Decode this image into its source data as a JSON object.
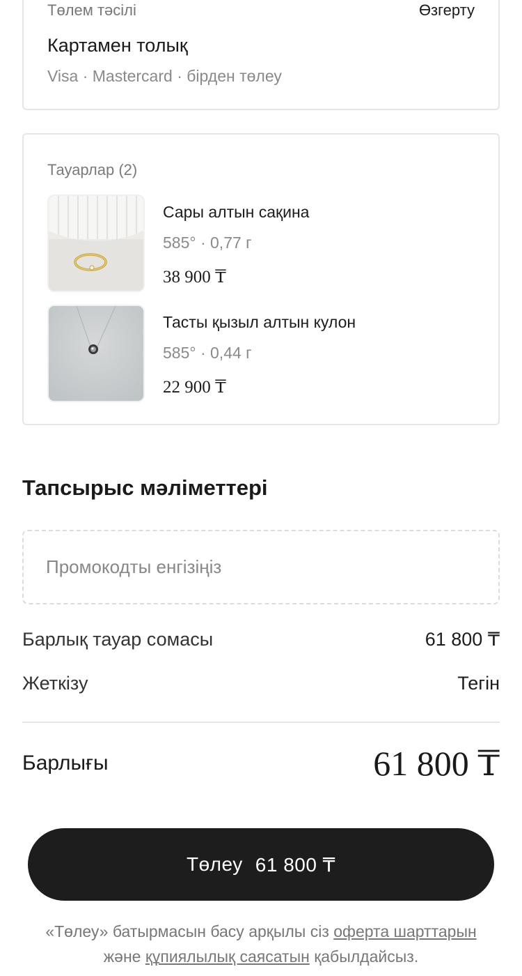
{
  "payment": {
    "label": "Төлем тәсілі",
    "change_label": "Өзгерту",
    "method": "Картамен толық",
    "subtitle": "Visa · Mastercard · бірден төлеу"
  },
  "goods": {
    "label": "Тауарлар (2)",
    "items": [
      {
        "name": "Сары алтын сақина",
        "spec": "585° · 0,77 г",
        "price": "38 900 ₸",
        "image": "gold-ring-photo"
      },
      {
        "name": "Тасты қызыл алтын кулон",
        "spec": "585° · 0,44 г",
        "price": "22 900 ₸",
        "image": "pendant-photo"
      }
    ]
  },
  "order": {
    "title": "Тапсырыс мәліметтері",
    "promo_placeholder": "Промокодты енгізіңіз",
    "goods_sum_label": "Барлық тауар сомасы",
    "goods_sum_value": "61 800 ₸",
    "delivery_label": "Жеткізу",
    "delivery_value": "Тегін",
    "total_label": "Барлығы",
    "total_value": "61 800 ₸"
  },
  "pay_button": {
    "label": "Төлеу",
    "amount": "61 800 ₸"
  },
  "legal": {
    "part1": "«Төлеу» батырмасын басу арқылы сіз ",
    "offer_link": "оферта шарттарын",
    "part2": " және ",
    "privacy_link": "құпиялылық саясатын",
    "part3": " қабылдайсыз."
  },
  "colors": {
    "button": "#1d1d1d",
    "border": "#e6e6e6",
    "muted_text": "#8a8a8a"
  }
}
